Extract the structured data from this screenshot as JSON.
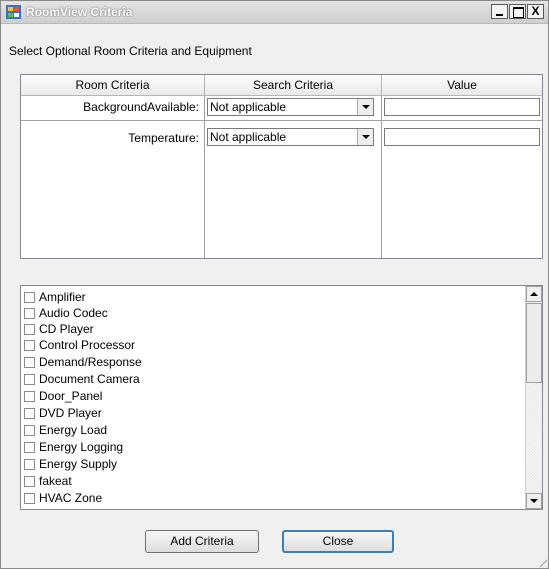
{
  "window": {
    "title": "RoomView Criteria",
    "controls": {
      "minimize": "_",
      "maximize": "□",
      "close": "X"
    }
  },
  "instruction": "Select Optional Room Criteria and Equipment",
  "criteria_grid": {
    "headers": [
      "Room Criteria",
      "Search Criteria",
      "Value"
    ],
    "rows": [
      {
        "criteria": "BackgroundAvailable:",
        "search": "Not applicable",
        "value": ""
      },
      {
        "criteria": "Temperature:",
        "search": "Not applicable",
        "value": ""
      }
    ]
  },
  "equipment_list": [
    {
      "label": "Amplifier",
      "checked": false
    },
    {
      "label": "Audio Codec",
      "checked": false
    },
    {
      "label": "CD Player",
      "checked": false
    },
    {
      "label": "Control Processor",
      "checked": false
    },
    {
      "label": "Demand/Response",
      "checked": false
    },
    {
      "label": "Document Camera",
      "checked": false
    },
    {
      "label": "Door_Panel",
      "checked": false
    },
    {
      "label": "DVD Player",
      "checked": false
    },
    {
      "label": "Energy Load",
      "checked": false
    },
    {
      "label": "Energy Logging",
      "checked": false
    },
    {
      "label": "Energy Supply",
      "checked": false
    },
    {
      "label": "fakeat",
      "checked": false
    },
    {
      "label": "HVAC Zone",
      "checked": false
    }
  ],
  "buttons": {
    "add_criteria": "Add Criteria",
    "close": "Close"
  },
  "colors": {
    "title_bar": "#d9d9d9",
    "window_bg": "#f0f0f0",
    "focus_border": "#3c7fb1"
  }
}
